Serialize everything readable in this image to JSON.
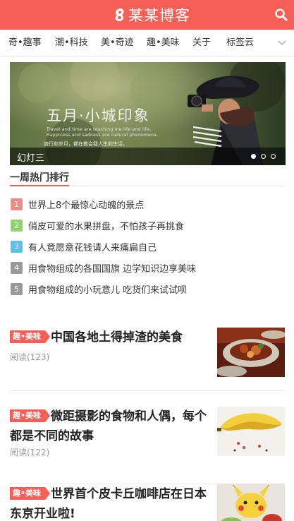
{
  "header": {
    "logo_text": "某某博客",
    "brand_color": "#f75f57",
    "search_icon": "search-icon"
  },
  "nav": {
    "items": [
      "奇•趣事",
      "潮•科技",
      "美•奇迹",
      "趣•美味",
      "关于",
      "标签云"
    ],
    "more_icon": "chevron-down-icon"
  },
  "slider": {
    "title": "五月·小城印象",
    "subtitle_line1": "Travel and time are teaching me life and life.",
    "subtitle_line2": "Happiness and sadness are natural phenomena.",
    "subtitle_line3": "旅行和岁月，都在教会我人生和生活。",
    "caption": "幻灯三",
    "slide_count": 3,
    "active_slide": 1
  },
  "ranking": {
    "title": "一周热门排行",
    "items": [
      {
        "num": "1",
        "text": "世界上8个最惊心动魄的景点",
        "color": "#f08b85"
      },
      {
        "num": "2",
        "text": "俏皮可爱的水果拼盘，不怕孩子再挑食",
        "color": "#8fd468"
      },
      {
        "num": "3",
        "text": "有人竟愿意花钱请人来痛扁自己",
        "color": "#5bc0eb"
      },
      {
        "num": "4",
        "text": "用食物组成的各国国旗 边学知识边享美味",
        "color": "#999999"
      },
      {
        "num": "5",
        "text": "用食物组成的小玩意儿 吃货们来试试呗",
        "color": "#999999"
      }
    ]
  },
  "articles": [
    {
      "tag": "趣•美味",
      "title": "中国各地土得掉渣的美食",
      "meta": "阅读(123)"
    },
    {
      "tag": "趣•美味",
      "title": "微距摄影的食物和人偶，每个都是不同的故事",
      "meta": "阅读(122)"
    },
    {
      "tag": "趣•美味",
      "title": "世界首个皮卡丘咖啡店在日本东京开业啦!",
      "meta": ""
    }
  ]
}
